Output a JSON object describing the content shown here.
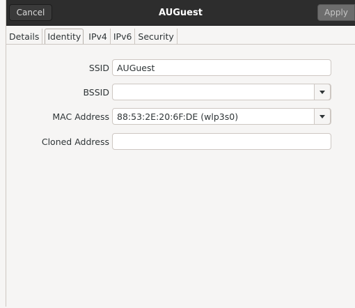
{
  "header": {
    "cancel_label": "Cancel",
    "title": "AUGuest",
    "apply_label": "Apply"
  },
  "tabs": [
    {
      "label": "Details"
    },
    {
      "label": "Identity"
    },
    {
      "label": "IPv4"
    },
    {
      "label": "IPv6"
    },
    {
      "label": "Security"
    }
  ],
  "active_tab": "Identity",
  "form": {
    "ssid": {
      "label": "SSID",
      "value": "AUGuest"
    },
    "bssid": {
      "label": "BSSID",
      "value": ""
    },
    "mac": {
      "label": "MAC Address",
      "value": "88:53:2E:20:6F:DE (wlp3s0)"
    },
    "cloned": {
      "label": "Cloned Address",
      "value": ""
    }
  },
  "colors": {
    "header_bg": "#2d2d2d",
    "window_bg": "#f6f5f4"
  },
  "icons": {
    "combo_arrow": "chevron-down-icon"
  }
}
